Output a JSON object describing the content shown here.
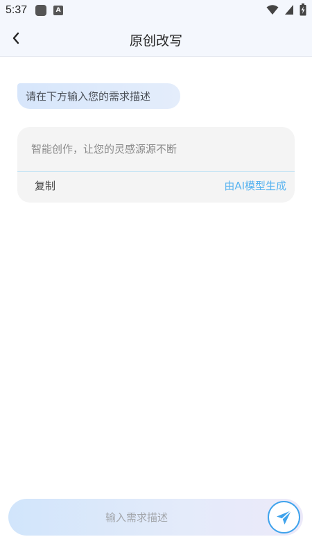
{
  "status_bar": {
    "time": "5:37",
    "icons": [
      "app-icon",
      "android-a-icon",
      "wifi-icon",
      "cell-signal-icon",
      "battery-charging-icon"
    ]
  },
  "header": {
    "title": "原创改写",
    "back_icon": "chevron-left-icon"
  },
  "conversation": {
    "prompt": "请在下方输入您的需求描述",
    "result_text": "智能创作，让您的灵感源源不断",
    "copy_label": "复制",
    "ai_note": "由AI模型生成"
  },
  "input": {
    "placeholder": "输入需求描述",
    "send_icon": "paper-plane-icon"
  },
  "colors": {
    "accent": "#3fa3ec",
    "ai_note": "#5ab4f0",
    "header_bg": "#f4f7fd",
    "card_bg": "#f4f4f4"
  }
}
